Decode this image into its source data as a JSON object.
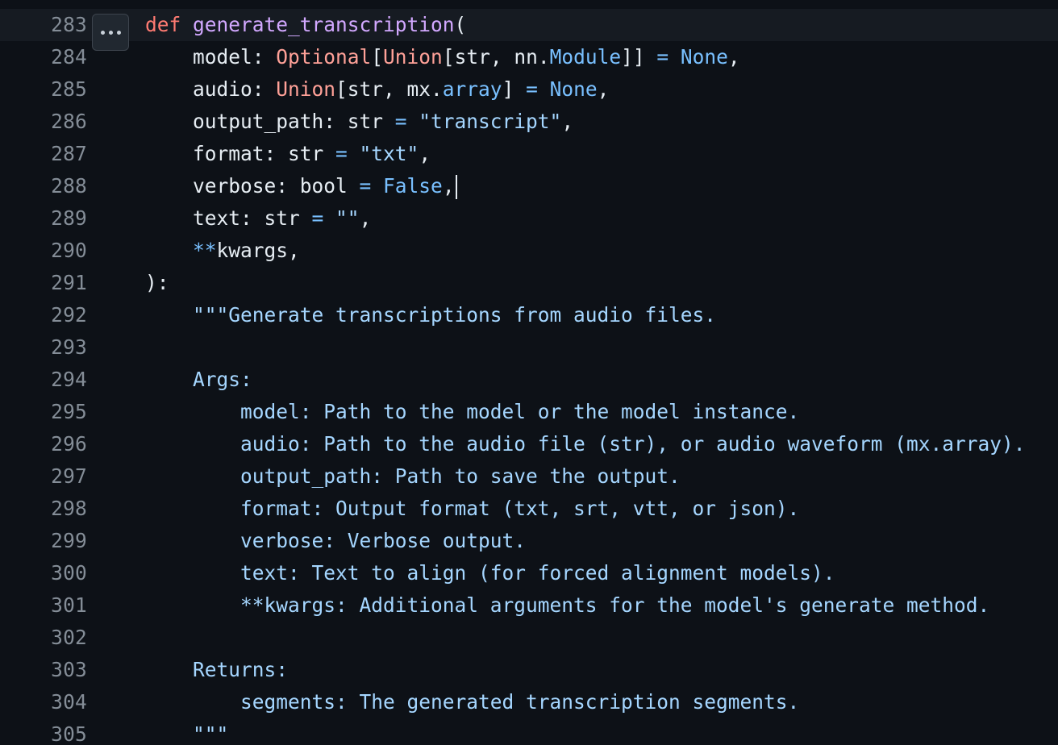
{
  "viewer": {
    "expand_button_label": "...",
    "lines": [
      {
        "num": "283",
        "segments": [
          [
            "kw",
            "def"
          ],
          [
            "txt",
            " "
          ],
          [
            "fn",
            "generate_transcription"
          ],
          [
            "txt",
            "("
          ]
        ]
      },
      {
        "num": "284",
        "segments": [
          [
            "txt",
            "    model: "
          ],
          [
            "cls",
            "Optional"
          ],
          [
            "txt",
            "["
          ],
          [
            "cls",
            "Union"
          ],
          [
            "txt",
            "[str, nn."
          ],
          [
            "op",
            "Module"
          ],
          [
            "txt",
            "]] "
          ],
          [
            "op",
            "="
          ],
          [
            "txt",
            " "
          ],
          [
            "con",
            "None"
          ],
          [
            "txt",
            ","
          ]
        ]
      },
      {
        "num": "285",
        "segments": [
          [
            "txt",
            "    audio: "
          ],
          [
            "cls",
            "Union"
          ],
          [
            "txt",
            "[str, mx."
          ],
          [
            "op",
            "array"
          ],
          [
            "txt",
            "] "
          ],
          [
            "op",
            "="
          ],
          [
            "txt",
            " "
          ],
          [
            "con",
            "None"
          ],
          [
            "txt",
            ","
          ]
        ]
      },
      {
        "num": "286",
        "segments": [
          [
            "txt",
            "    output_path: str "
          ],
          [
            "op",
            "="
          ],
          [
            "txt",
            " "
          ],
          [
            "str",
            "\"transcript\""
          ],
          [
            "txt",
            ","
          ]
        ]
      },
      {
        "num": "287",
        "segments": [
          [
            "txt",
            "    format: str "
          ],
          [
            "op",
            "="
          ],
          [
            "txt",
            " "
          ],
          [
            "str",
            "\"txt\""
          ],
          [
            "txt",
            ","
          ]
        ]
      },
      {
        "num": "288",
        "segments": [
          [
            "txt",
            "    verbose: bool "
          ],
          [
            "op",
            "="
          ],
          [
            "txt",
            " "
          ],
          [
            "con",
            "False"
          ],
          [
            "txt",
            ","
          ]
        ],
        "cursor": true
      },
      {
        "num": "289",
        "segments": [
          [
            "txt",
            "    text: str "
          ],
          [
            "op",
            "="
          ],
          [
            "txt",
            " "
          ],
          [
            "str",
            "\"\""
          ],
          [
            "txt",
            ","
          ]
        ]
      },
      {
        "num": "290",
        "segments": [
          [
            "txt",
            "    "
          ],
          [
            "op",
            "**"
          ],
          [
            "txt",
            "kwargs,"
          ]
        ]
      },
      {
        "num": "291",
        "segments": [
          [
            "txt",
            "):"
          ]
        ]
      },
      {
        "num": "292",
        "segments": [
          [
            "txt",
            "    "
          ],
          [
            "doc",
            "\"\"\"Generate transcriptions from audio files."
          ]
        ]
      },
      {
        "num": "293",
        "segments": []
      },
      {
        "num": "294",
        "segments": [
          [
            "txt",
            "    "
          ],
          [
            "doc",
            "Args:"
          ]
        ]
      },
      {
        "num": "295",
        "segments": [
          [
            "txt",
            "        "
          ],
          [
            "doc",
            "model: Path to the model or the model instance."
          ]
        ]
      },
      {
        "num": "296",
        "segments": [
          [
            "txt",
            "        "
          ],
          [
            "doc",
            "audio: Path to the audio file (str), or audio waveform (mx.array)."
          ]
        ]
      },
      {
        "num": "297",
        "segments": [
          [
            "txt",
            "        "
          ],
          [
            "doc",
            "output_path: Path to save the output."
          ]
        ]
      },
      {
        "num": "298",
        "segments": [
          [
            "txt",
            "        "
          ],
          [
            "doc",
            "format: Output format (txt, srt, vtt, or json)."
          ]
        ]
      },
      {
        "num": "299",
        "segments": [
          [
            "txt",
            "        "
          ],
          [
            "doc",
            "verbose: Verbose output."
          ]
        ]
      },
      {
        "num": "300",
        "segments": [
          [
            "txt",
            "        "
          ],
          [
            "doc",
            "text: Text to align (for forced alignment models)."
          ]
        ]
      },
      {
        "num": "301",
        "segments": [
          [
            "txt",
            "        "
          ],
          [
            "doc",
            "**kwargs: Additional arguments for the model's generate method."
          ]
        ]
      },
      {
        "num": "302",
        "segments": []
      },
      {
        "num": "303",
        "segments": [
          [
            "txt",
            "    "
          ],
          [
            "doc",
            "Returns:"
          ]
        ]
      },
      {
        "num": "304",
        "segments": [
          [
            "txt",
            "        "
          ],
          [
            "doc",
            "segments: The generated transcription segments."
          ]
        ]
      },
      {
        "num": "305",
        "segments": [
          [
            "txt",
            "    "
          ],
          [
            "doc",
            "\"\"\""
          ]
        ]
      }
    ]
  },
  "colors": {
    "background": "#0d1117",
    "active_line": "#161b22",
    "line_number": "#848d97",
    "keyword": "#ff7b72",
    "function": "#d2a8ff",
    "operator": "#79c0ff",
    "class": "#ffa198",
    "string": "#a5d6ff",
    "text": "#e6edf3"
  }
}
